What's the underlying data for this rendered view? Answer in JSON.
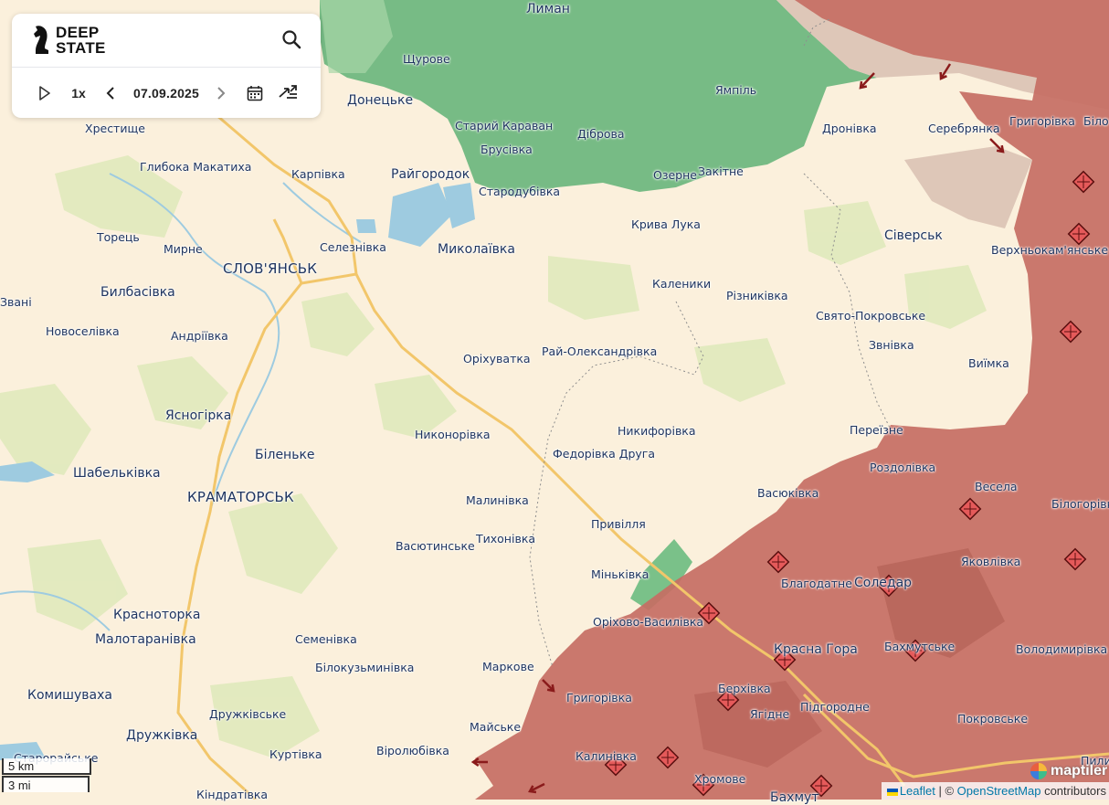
{
  "header": {
    "logo_line1": "DEEP",
    "logo_line2": "STATE",
    "speed": "1x",
    "date": "07.09.2025"
  },
  "icons": {
    "logo": "knight-chess-icon",
    "search": "search-icon",
    "play": "play-icon",
    "prev": "chevron-left-icon",
    "next": "chevron-right-icon",
    "calendar": "calendar-icon",
    "compare": "compare-arrows-icon",
    "fortification": "fortification-icon",
    "attack": "attack-arrow-icon"
  },
  "colors": {
    "land": "#fbf0dc",
    "occupied": "#c56e63",
    "liberated": "#5fb276",
    "contested": "#d8bfb2",
    "water": "#9ecbe0",
    "road": "#f2c66a"
  },
  "places": [
    {
      "name": "Лиман",
      "cls": "town"
    },
    {
      "name": "Щурове",
      "cls": "small"
    },
    {
      "name": "Донецьке",
      "cls": "town"
    },
    {
      "name": "Хрестище",
      "cls": "small"
    },
    {
      "name": "Старий Караван",
      "cls": "small"
    },
    {
      "name": "Брусівка",
      "cls": "small"
    },
    {
      "name": "Діброва",
      "cls": "small"
    },
    {
      "name": "Ямпіль",
      "cls": "small"
    },
    {
      "name": "Дронівка",
      "cls": "small"
    },
    {
      "name": "Серебрянка",
      "cls": "small"
    },
    {
      "name": "Григорівка",
      "cls": "small"
    },
    {
      "name": "Біло",
      "cls": "small"
    },
    {
      "name": "Глибока Макатиха",
      "cls": "small"
    },
    {
      "name": "Карпівка",
      "cls": "small"
    },
    {
      "name": "Райгородок",
      "cls": "town"
    },
    {
      "name": "Озерне",
      "cls": "small"
    },
    {
      "name": "Закітне",
      "cls": "small"
    },
    {
      "name": "Стародубівка",
      "cls": "small"
    },
    {
      "name": "Крива Лука",
      "cls": "small"
    },
    {
      "name": "Торець",
      "cls": "small"
    },
    {
      "name": "Мирне",
      "cls": "small"
    },
    {
      "name": "Селезнівка",
      "cls": "small"
    },
    {
      "name": "Миколаївка",
      "cls": "town"
    },
    {
      "name": "Сіверськ",
      "cls": "town"
    },
    {
      "name": "Верхньокам'янське",
      "cls": "small"
    },
    {
      "name": "СЛОВ'ЯНСЬК",
      "cls": "city"
    },
    {
      "name": "Билбасівка",
      "cls": "town"
    },
    {
      "name": "Каленики",
      "cls": "small"
    },
    {
      "name": "Різниківка",
      "cls": "small"
    },
    {
      "name": "Свято-Покровське",
      "cls": "small"
    },
    {
      "name": "Новоселівка",
      "cls": "small"
    },
    {
      "name": "Андріївка",
      "cls": "small"
    },
    {
      "name": "Звані",
      "cls": "small"
    },
    {
      "name": "Звнівка",
      "cls": "small"
    },
    {
      "name": "Оріхуватка",
      "cls": "small"
    },
    {
      "name": "Рай-Олександрівка",
      "cls": "small"
    },
    {
      "name": "Виїмка",
      "cls": "small"
    },
    {
      "name": "Ясногірка",
      "cls": "town"
    },
    {
      "name": "Никонорівка",
      "cls": "small"
    },
    {
      "name": "Никифорівка",
      "cls": "small"
    },
    {
      "name": "Переїзне",
      "cls": "small"
    },
    {
      "name": "Біленьке",
      "cls": "town"
    },
    {
      "name": "Федорівка Друга",
      "cls": "small"
    },
    {
      "name": "Роздолівка",
      "cls": "small"
    },
    {
      "name": "Шабельківка",
      "cls": "town"
    },
    {
      "name": "Весела",
      "cls": "small"
    },
    {
      "name": "КРАМАТОРСЬК",
      "cls": "city"
    },
    {
      "name": "Васюківка",
      "cls": "small"
    },
    {
      "name": "Малинівка",
      "cls": "small"
    },
    {
      "name": "Білогорівка",
      "cls": "small"
    },
    {
      "name": "Тихонівка",
      "cls": "small"
    },
    {
      "name": "Привілля",
      "cls": "small"
    },
    {
      "name": "Васютинське",
      "cls": "small"
    },
    {
      "name": "Яковлівка",
      "cls": "small"
    },
    {
      "name": "Міньківка",
      "cls": "small"
    },
    {
      "name": "Благодатне",
      "cls": "small"
    },
    {
      "name": "Соледар",
      "cls": "town"
    },
    {
      "name": "Краснoторка",
      "cls": "town"
    },
    {
      "name": "Оріхово-Василівка",
      "cls": "small"
    },
    {
      "name": "Малотаранівка",
      "cls": "town"
    },
    {
      "name": "Семенівка",
      "cls": "small"
    },
    {
      "name": "Красна Гора",
      "cls": "town"
    },
    {
      "name": "Бахмутське",
      "cls": "small"
    },
    {
      "name": "Володимирівка",
      "cls": "small"
    },
    {
      "name": "Білокузьминівка",
      "cls": "small"
    },
    {
      "name": "Маркове",
      "cls": "small"
    },
    {
      "name": "Комишуваха",
      "cls": "town"
    },
    {
      "name": "Григорівка",
      "cls": "small"
    },
    {
      "name": "Берхівка",
      "cls": "small"
    },
    {
      "name": "Ягідне",
      "cls": "small"
    },
    {
      "name": "Підгородне",
      "cls": "small"
    },
    {
      "name": "Дружківське",
      "cls": "small"
    },
    {
      "name": "Покровське",
      "cls": "small"
    },
    {
      "name": "Дружківка",
      "cls": "town"
    },
    {
      "name": "Майське",
      "cls": "small"
    },
    {
      "name": "Старорайське",
      "cls": "small"
    },
    {
      "name": "Куртівка",
      "cls": "small"
    },
    {
      "name": "Віролюбівка",
      "cls": "small"
    },
    {
      "name": "Калинівка",
      "cls": "small"
    },
    {
      "name": "Хромове",
      "cls": "small"
    },
    {
      "name": "Пили",
      "cls": "small"
    },
    {
      "name": "Кіндратівка",
      "cls": "small"
    },
    {
      "name": "Бахмут",
      "cls": "town"
    }
  ],
  "scale": {
    "km": "5 km",
    "mi": "3 mi"
  },
  "maptiler": "maptiler",
  "attribution": {
    "leaflet": "Leaflet",
    "sep": " | © ",
    "osm": "OpenStreetMap",
    "contributors": " contributors"
  }
}
